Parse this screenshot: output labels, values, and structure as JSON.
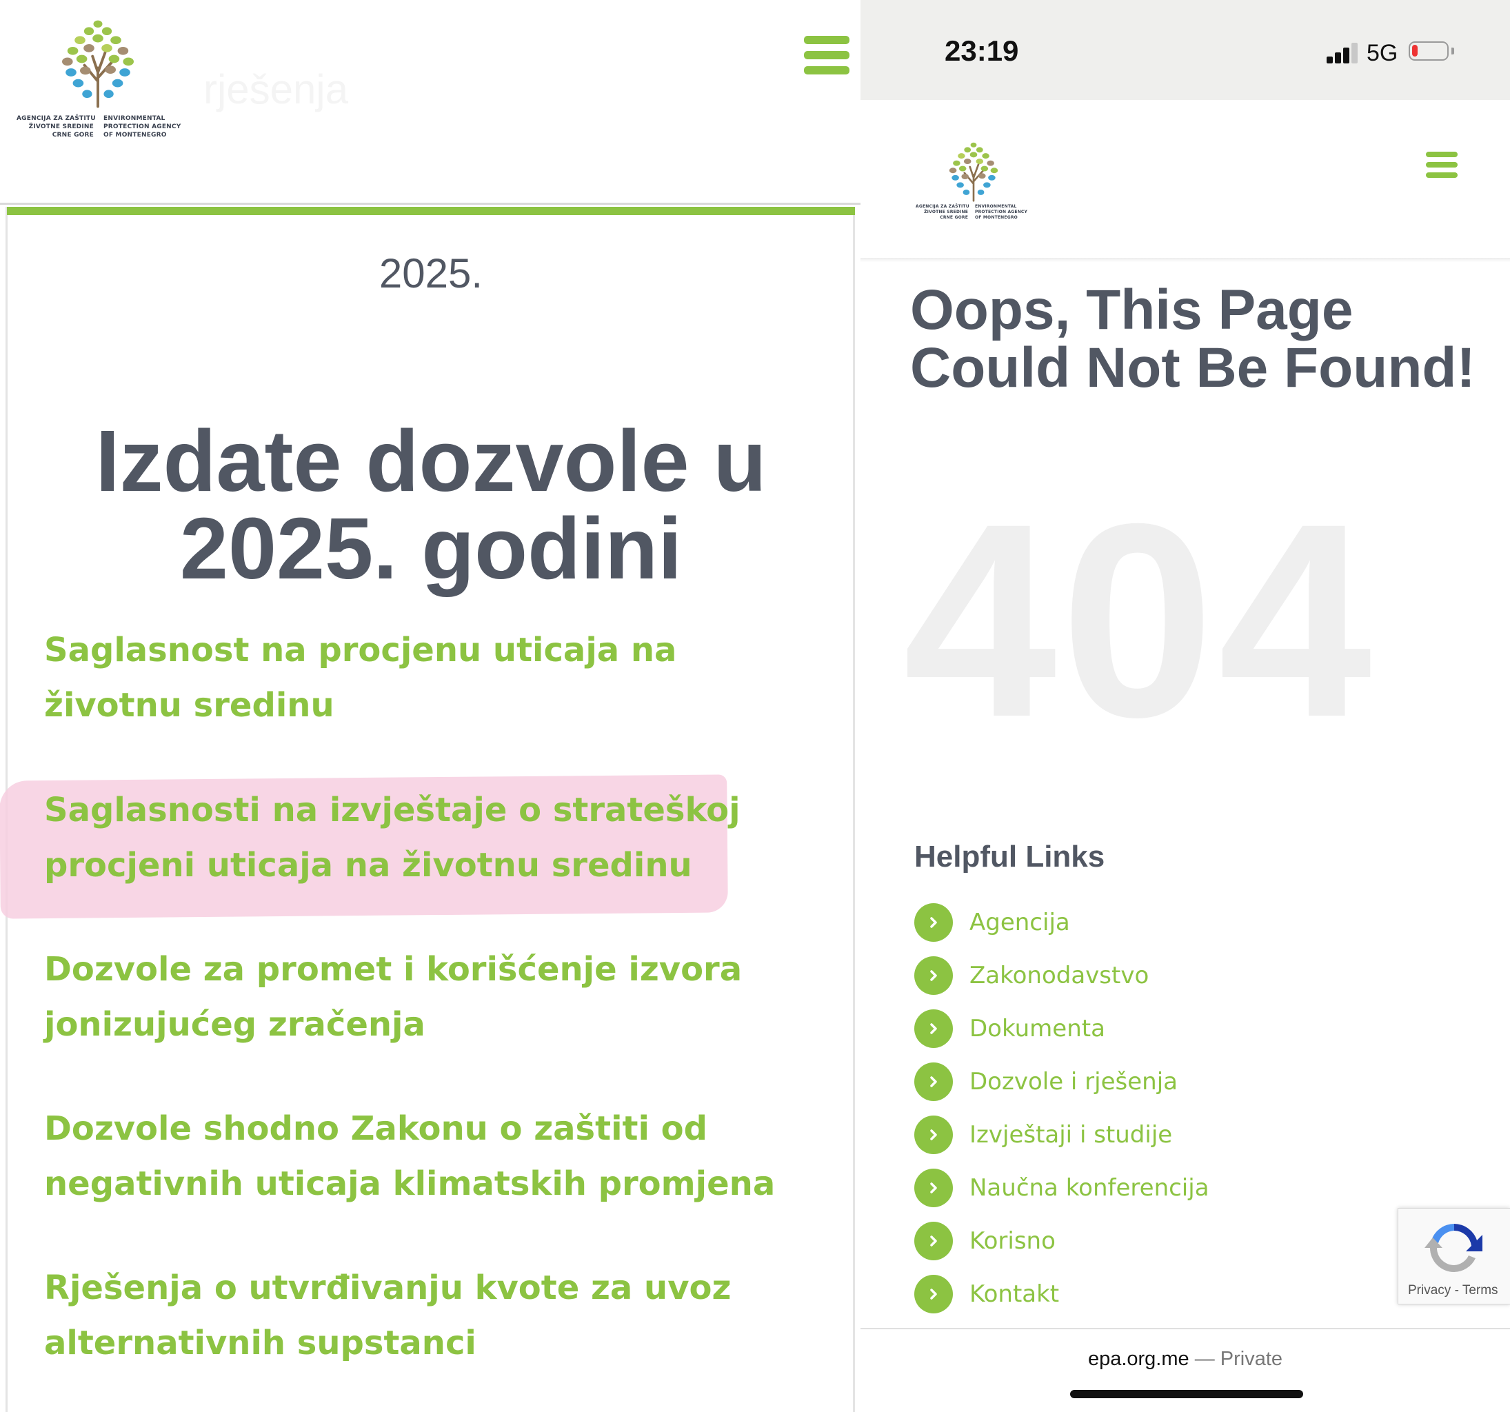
{
  "left": {
    "logo": {
      "caption_left": [
        "AGENCIJA ZA ZAŠTITU",
        "ŽIVOTNE SREDINE",
        "CRNE GORE"
      ],
      "caption_right": [
        "ENVIRONMENTAL",
        "PROTECTION AGENCY",
        "OF MONTENEGRO"
      ]
    },
    "ghost_text": "rješenja",
    "year": "2025.",
    "title": "Izdate dozvole u 2025. godini",
    "permit_links": [
      "Saglasnost na procjenu uticaja na životnu sredinu",
      "Saglasnosti na izvještaje o strateškoj procjeni uticaja na životnu sredinu",
      "Dozvole za promet i korišćenje izvora jonizujućeg zračenja",
      "Dozvole shodno Zakonu o zaštiti od negativnih uticaja klimatskih promjena",
      "Rješenja o utvrđivanju kvote za uvoz alternativnih supstanci"
    ],
    "highlighted_index": 1
  },
  "right": {
    "status_bar": {
      "time": "23:19",
      "network": "5G"
    },
    "error_title": "Oops, This Page Could Not Be Found!",
    "error_code": "404",
    "helpful_links_title": "Helpful Links",
    "helpful_links": [
      "Agencija",
      "Zakonodavstvo",
      "Dokumenta",
      "Dozvole i rješenja",
      "Izvještaji i studije",
      "Naučna konferencija",
      "Korisno",
      "Kontakt"
    ],
    "recaptcha_links": "Privacy - Terms",
    "url_bar": {
      "domain": "epa.org.me",
      "separator": " — ",
      "mode": "Private"
    }
  },
  "colors": {
    "brand_green": "#8cc342",
    "heading_gray": "#515763",
    "highlight_pink": "#f7cfe0",
    "ghost_gray": "#efefef"
  },
  "icons": [
    "hamburger-menu-icon",
    "chevron-right-icon",
    "recaptcha-icon",
    "signal-icon",
    "battery-icon"
  ]
}
